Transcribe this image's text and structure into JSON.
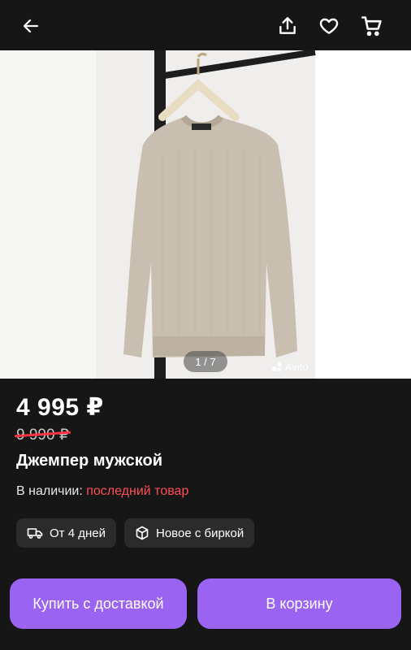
{
  "header": {
    "back_icon": "arrow-left-icon",
    "share_icon": "share-icon",
    "favorite_icon": "heart-icon",
    "cart_icon": "cart-icon"
  },
  "gallery": {
    "counter": "1 / 7",
    "watermark": "Avito"
  },
  "product": {
    "price": "4 995 ₽",
    "old_price": "9 990 ₽",
    "title": "Джемпер мужской",
    "stock_label": "В наличии:",
    "stock_status": "последний товар"
  },
  "chips": [
    {
      "icon": "truck-icon",
      "label": "От 4 дней"
    },
    {
      "icon": "box-icon",
      "label": "Новое с биркой"
    }
  ],
  "actions": {
    "buy_label": "Купить с доставкой",
    "cart_label": "В корзину"
  },
  "colors": {
    "background": "#161616",
    "accent": "#9a63f2",
    "alert": "#ff4d55"
  }
}
